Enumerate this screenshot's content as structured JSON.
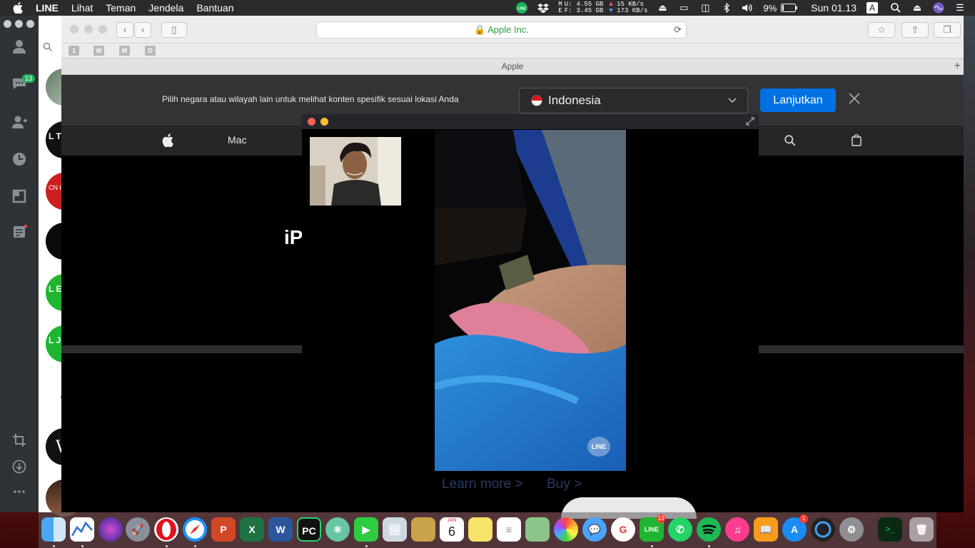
{
  "menubar": {
    "app_name": "LINE",
    "menus": [
      "Lihat",
      "Teman",
      "Jendela",
      "Bantuan"
    ],
    "disk_u": "4.55 GB",
    "disk_f": "3.45 GB",
    "net_up": "15 KB/s",
    "net_down": "173 KB/s",
    "battery": "9%",
    "clock": "Sun 01.13",
    "input_source": "A",
    "disk_label_u": "U:",
    "disk_label_f": "F:",
    "disk_label_m": "M",
    "disk_label_e": "E"
  },
  "line_sidebar": {
    "chat_badge": "13",
    "icons": [
      "friends-icon",
      "chats-icon",
      "add-friend-icon",
      "timeline-icon",
      "keep-icon",
      "notes-icon",
      "screenshot-icon",
      "download-icon",
      "more-icon"
    ]
  },
  "chat_list": {
    "avatar_text": [
      "L TO",
      "CN Indo",
      "",
      "L EV",
      "L JO",
      "A",
      "W"
    ]
  },
  "safari": {
    "url": "Apple Inc.",
    "tab_title": "Apple",
    "favorites": [
      "1",
      "W",
      "M",
      "D"
    ]
  },
  "page": {
    "banner_text": "Pilih negara atau wilayah lain untuk melihat konten spesifik sesuai lokasi Anda",
    "country": "Indonesia",
    "continue_label": "Lanjutkan",
    "nav_mac": "Mac",
    "hero_partial": "iP",
    "learn_more": "Learn more >",
    "buy": "Buy >"
  },
  "call_window": {
    "watermark": "LINE"
  },
  "dock": {
    "apps": [
      "Finder",
      "Activity Monitor",
      "Siri",
      "Launchpad",
      "Opera",
      "Safari",
      "PowerPoint",
      "Excel",
      "Word",
      "PyCharm",
      "Atom",
      "FaceTime",
      "Preview",
      "Notes",
      "Calendar",
      "Stickies",
      "Reminders",
      "Maps",
      "Photos",
      "Messages",
      "Google",
      "LINE",
      "WhatsApp",
      "Spotify",
      "iTunes",
      "Books",
      "App Store",
      "Camo",
      "System Preferences",
      "Terminal",
      "Trash"
    ],
    "calendar_month": "JAN",
    "calendar_day": "6",
    "line_badge": "13",
    "appstore_badge": "1"
  }
}
